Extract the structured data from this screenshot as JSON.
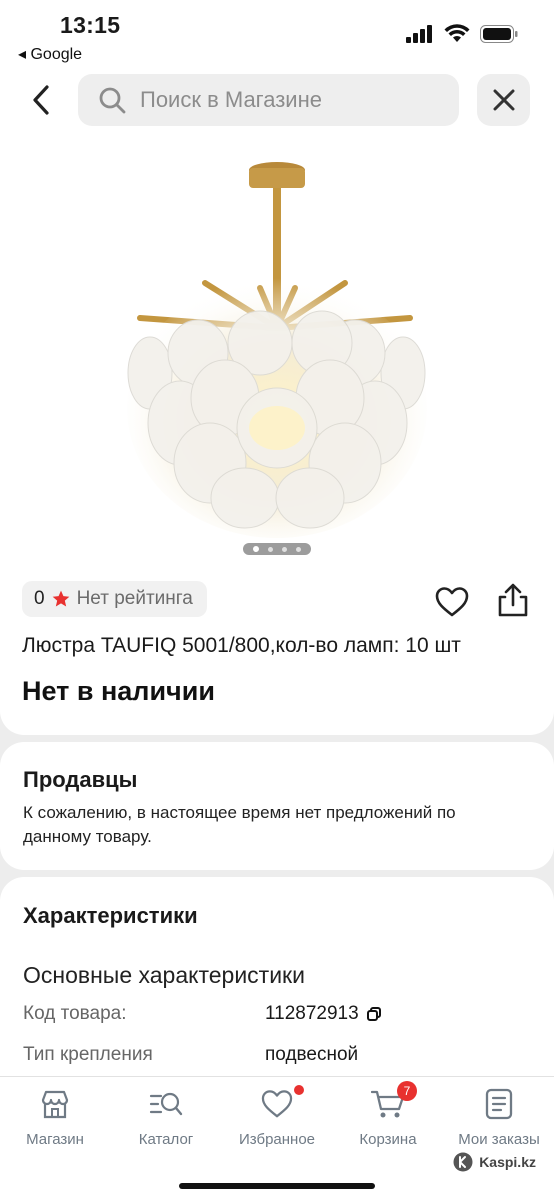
{
  "status_bar": {
    "time": "13:15",
    "back_app": "◂ Google"
  },
  "header": {
    "search_placeholder": "Поиск в Магазине"
  },
  "product": {
    "rating_count": "0",
    "rating_text": "Нет рейтинга",
    "title": "Люстра TAUFIQ 5001/800,кол-во ламп: 10 шт",
    "availability": "Нет в наличии",
    "image_count": 4,
    "active_image_index": 0
  },
  "sellers": {
    "title": "Продавцы",
    "text": "К сожалению, в настоящее время нет предложений по данному товару."
  },
  "specs": {
    "title": "Характеристики",
    "subtitle": "Основные характеристики",
    "rows": [
      {
        "key": "Код товара:",
        "value": "112872913"
      },
      {
        "key": "Тип крепления",
        "value": "подвесной"
      }
    ]
  },
  "bottom_nav": {
    "items": [
      {
        "label": "Магазин",
        "icon": "store-icon"
      },
      {
        "label": "Каталог",
        "icon": "catalog-search-icon"
      },
      {
        "label": "Избранное",
        "icon": "heart-icon"
      },
      {
        "label": "Корзина",
        "icon": "cart-icon",
        "badge": "7"
      },
      {
        "label": "Мои заказы",
        "icon": "orders-icon"
      }
    ]
  },
  "brand": "Kaspi.kz",
  "colors": {
    "badge_red": "#e8312f",
    "nav_gray": "#6f7a85",
    "background": "#ededed"
  }
}
